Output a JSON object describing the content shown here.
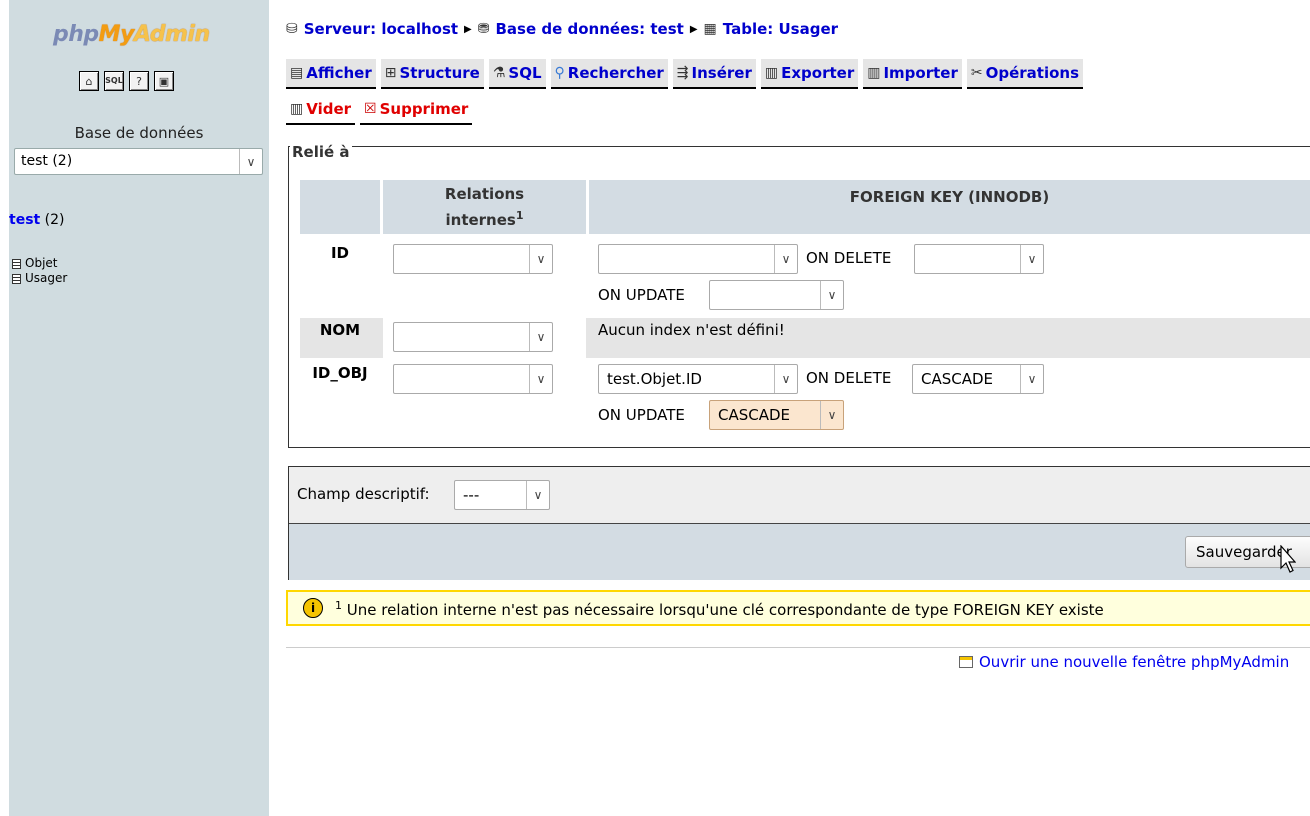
{
  "logo": {
    "php": "php",
    "my": "My",
    "admin": "Admin"
  },
  "quick_icons": [
    "home-icon",
    "sql-query-icon",
    "documentation-icon",
    "sql-docs-icon"
  ],
  "sidebar": {
    "db_label": "Base de données",
    "db_select_value": "test (2)",
    "db_name": "test",
    "db_count": "(2)",
    "tables": [
      "Objet",
      "Usager"
    ]
  },
  "breadcrumb": {
    "server": "Serveur: localhost",
    "database": "Base de données: test",
    "table": "Table: Usager"
  },
  "tabs": [
    {
      "label": "Afficher",
      "icon": "browse-icon",
      "danger": false
    },
    {
      "label": "Structure",
      "icon": "structure-icon",
      "danger": false
    },
    {
      "label": "SQL",
      "icon": "sql-icon",
      "danger": false
    },
    {
      "label": "Rechercher",
      "icon": "search-icon",
      "danger": false
    },
    {
      "label": "Insérer",
      "icon": "insert-icon",
      "danger": false
    },
    {
      "label": "Exporter",
      "icon": "export-icon",
      "danger": false
    },
    {
      "label": "Importer",
      "icon": "import-icon",
      "danger": false
    },
    {
      "label": "Opérations",
      "icon": "operations-icon",
      "danger": false
    },
    {
      "label": "Vider",
      "icon": "empty-icon",
      "danger": true
    },
    {
      "label": "Supprimer",
      "icon": "drop-icon",
      "danger": true
    }
  ],
  "relations": {
    "legend": "Relié à",
    "col_internal_1": "Relations",
    "col_internal_2": "internes",
    "col_internal_sup": "1",
    "col_fk": "FOREIGN KEY (INNODB)",
    "on_delete": "ON DELETE",
    "on_update": "ON UPDATE",
    "rows": [
      {
        "name": "ID",
        "internal": "",
        "fk": "",
        "on_delete": "",
        "on_update": ""
      },
      {
        "name": "NOM",
        "internal": "",
        "no_index": "Aucun index n'est défini!"
      },
      {
        "name": "ID_OBJ",
        "internal": "",
        "fk": "test.Objet.ID",
        "on_delete": "CASCADE",
        "on_update": "CASCADE"
      }
    ]
  },
  "descriptive": {
    "label": "Champ descriptif:",
    "value": "---",
    "save_label": "Sauvegarder"
  },
  "notice": {
    "sup": "1",
    "text": " Une relation interne n'est pas nécessaire lorsqu'une clé correspondante de type FOREIGN KEY existe"
  },
  "footer": {
    "new_window": "Ouvrir une nouvelle fenêtre phpMyAdmin"
  }
}
